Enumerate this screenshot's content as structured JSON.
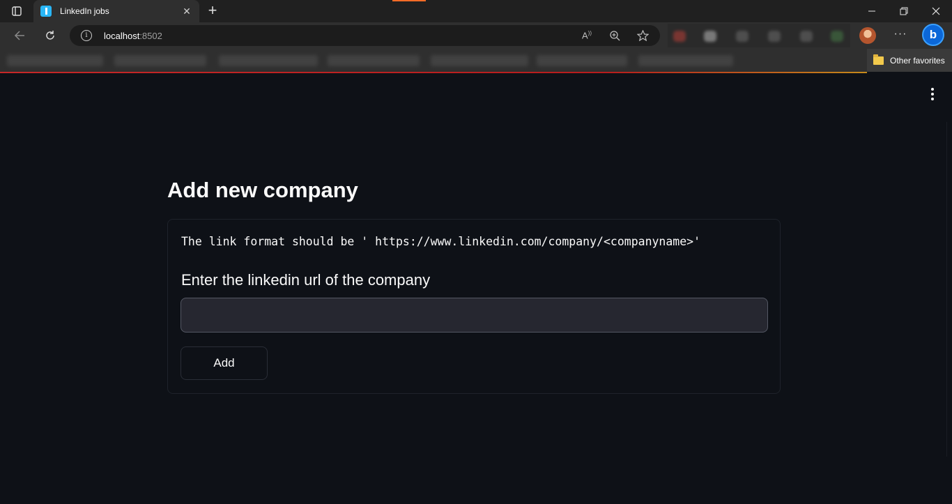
{
  "browser": {
    "tab_title": "LinkedIn jobs",
    "tab_close": "✕",
    "new_tab": "+",
    "url_host": "localhost",
    "url_port": ":8502",
    "other_favorites": "Other favorites",
    "bing_glyph": "b"
  },
  "page": {
    "title": "Add new company",
    "hint": "The link format should be ' https://www.linkedin.com/company/<companyname>'",
    "field_label": "Enter the linkedin url of the company",
    "input_value": "",
    "add_button": "Add"
  },
  "colors": {
    "background": "#0e1117",
    "text": "#fafafa",
    "input_bg": "#262730",
    "favicon": "#29b6f6",
    "bing": "#0b67d8"
  }
}
